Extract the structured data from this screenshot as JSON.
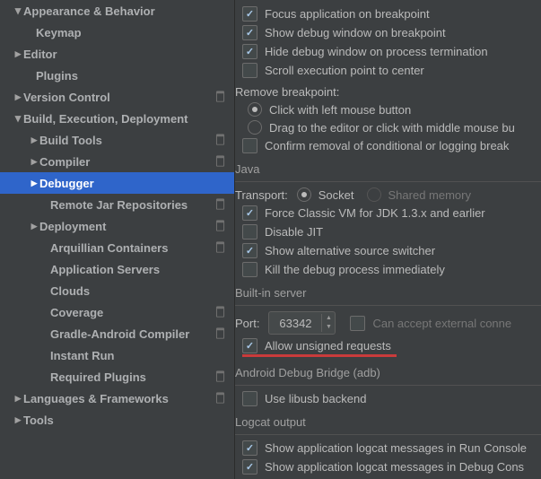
{
  "sidebar": {
    "items": [
      {
        "label": "Appearance & Behavior",
        "indent": 14,
        "chev": "▾"
      },
      {
        "label": "Keymap",
        "indent": 28,
        "chev": ""
      },
      {
        "label": "Editor",
        "indent": 14,
        "chev": "▸"
      },
      {
        "label": "Plugins",
        "indent": 28,
        "chev": ""
      },
      {
        "label": "Version Control",
        "indent": 14,
        "chev": "▸",
        "badge": true
      },
      {
        "label": "Build, Execution, Deployment",
        "indent": 14,
        "chev": "▾"
      },
      {
        "label": "Build Tools",
        "indent": 32,
        "chev": "▸",
        "badge": true
      },
      {
        "label": "Compiler",
        "indent": 32,
        "chev": "▸",
        "badge": true
      },
      {
        "label": "Debugger",
        "indent": 32,
        "chev": "▸",
        "active": true
      },
      {
        "label": "Remote Jar Repositories",
        "indent": 44,
        "chev": "",
        "badge": true
      },
      {
        "label": "Deployment",
        "indent": 32,
        "chev": "▸",
        "badge": true
      },
      {
        "label": "Arquillian Containers",
        "indent": 44,
        "chev": "",
        "badge": true
      },
      {
        "label": "Application Servers",
        "indent": 44,
        "chev": ""
      },
      {
        "label": "Clouds",
        "indent": 44,
        "chev": ""
      },
      {
        "label": "Coverage",
        "indent": 44,
        "chev": "",
        "badge": true
      },
      {
        "label": "Gradle-Android Compiler",
        "indent": 44,
        "chev": "",
        "badge": true
      },
      {
        "label": "Instant Run",
        "indent": 44,
        "chev": ""
      },
      {
        "label": "Required Plugins",
        "indent": 44,
        "chev": "",
        "badge": true
      },
      {
        "label": "Languages & Frameworks",
        "indent": 14,
        "chev": "▸",
        "badge": true
      },
      {
        "label": "Tools",
        "indent": 14,
        "chev": "▸"
      }
    ]
  },
  "main": {
    "top_checks": [
      {
        "label": "Focus application on breakpoint",
        "checked": true
      },
      {
        "label": "Show debug window on breakpoint",
        "checked": true
      },
      {
        "label": "Hide debug window on process termination",
        "checked": true
      },
      {
        "label": "Scroll execution point to center",
        "checked": false
      }
    ],
    "remove_breakpoint_label": "Remove breakpoint:",
    "remove_radios": [
      {
        "label": "Click with left mouse button",
        "checked": true
      },
      {
        "label": "Drag to the editor or click with middle mouse bu",
        "checked": false
      }
    ],
    "confirm_removal": {
      "label": "Confirm removal of conditional or logging break",
      "checked": false
    },
    "java": {
      "title": "Java",
      "transport_label": "Transport:",
      "socket": "Socket",
      "shared": "Shared memory",
      "checks": [
        {
          "label": "Force Classic VM for JDK 1.3.x and earlier",
          "checked": true
        },
        {
          "label": "Disable JIT",
          "checked": false
        },
        {
          "label": "Show alternative source switcher",
          "checked": true
        },
        {
          "label": "Kill the debug process immediately",
          "checked": false
        }
      ]
    },
    "builtin": {
      "title": "Built-in server",
      "port_label": "Port:",
      "port_value": "63342",
      "can_accept": "Can accept external conne",
      "allow_unsigned": {
        "label": "Allow unsigned requests",
        "checked": true
      }
    },
    "adb": {
      "title": "Android Debug Bridge (adb)",
      "libusb": {
        "label": "Use libusb backend",
        "checked": false
      }
    },
    "logcat": {
      "title": "Logcat output",
      "checks": [
        {
          "label": "Show application logcat messages in Run Console",
          "checked": true
        },
        {
          "label": "Show application logcat messages in Debug Cons",
          "checked": true
        }
      ]
    }
  }
}
